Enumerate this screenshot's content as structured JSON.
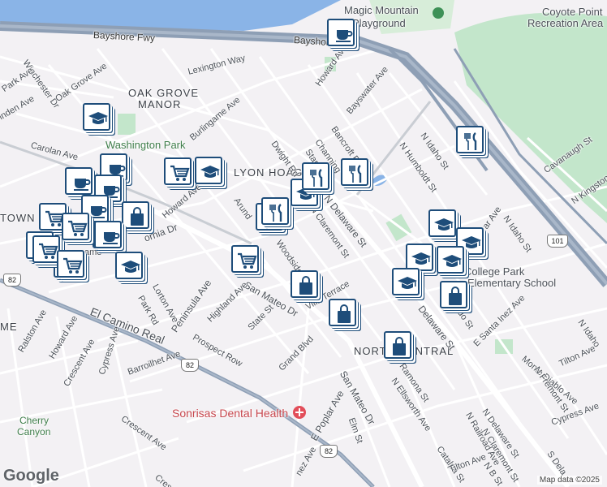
{
  "colors": {
    "pin_border": "#1e4d7a",
    "water": "#8ab4e7",
    "park": "#c3e6cb",
    "freeway": "#8e9fb5"
  },
  "labels": {
    "bayshore_fwy_1": "Bayshore Fwy",
    "bayshore_fwy_2": "Bayshore Fwy",
    "magic_mountain": "Magic Mountain",
    "playground": "Playground",
    "coyote_point_1": "Coyote Point",
    "coyote_point_2": "Recreation Area",
    "oak_grove_1": "OAK GROVE",
    "oak_grove_2": "MANOR",
    "washington_park": "Washington Park",
    "lyon_hoag": "LYON HOAG",
    "college_park_1": "College Park",
    "college_park_2": "Elementary School",
    "north_central": "NORTH CENTRAL",
    "sonrisas": "Sonrisas Dental Health",
    "cherry_1": "Cherry",
    "cherry_2": "Canyon",
    "town": "TOWN",
    "me": "ME",
    "ame": "ame",
    "lexington": "Lexington Way",
    "howard_ave_top": "Howard Ave",
    "winchester": "Winchester Dr",
    "park_ave_top": "Park Ave",
    "oak_grove_ave": "Oak Grove Ave",
    "linden": "inden Ave",
    "carolan": "Carolan Ave",
    "burlingame": "Burlingame Ave",
    "bayswater": "Bayswater Ave",
    "bancroft": "Bancroft Rd",
    "channing": "Channing",
    "stanley": "Stanl",
    "dwight": "Dwight Rd",
    "n_idaho_1": "N Idaho St",
    "n_humboldt": "N Humboldt St",
    "cavanaugh": "Cavanaugh St",
    "n_kingston": "N Kingston St",
    "n_idaho_2": "N Idaho St",
    "bar_ave": "ar Ave",
    "n_delaware_1": "N Delaware St",
    "n_claremont_1": "N Claremont St",
    "arundel": "Arund",
    "woodside": "Woodside",
    "howard_ave_mid": "Howard Ave",
    "california": "ornia Dr",
    "lorton": "Lorton Ave",
    "peninsula": "Peninsula Ave",
    "san_mateo_dr_1": "San Mateo Dr",
    "villa_terrace": "Villa Terrace",
    "highland": "Highland Ave",
    "state_st": "State St",
    "park_rd": "Park Rd",
    "el_camino": "El Camino Real",
    "prospect": "Prospect Row",
    "barroilhet": "Barroilhet Ave",
    "ralston": "Ralston Ave",
    "howard_ave_low": "Howard Ave",
    "crescent_1": "Crescent Ave",
    "cypress_1": "Cypress Ave",
    "crescent_2": "Crescent Ave",
    "crescent_3": "Crescen",
    "grand_blvd": "Grand Blvd",
    "san_mateo_dr_2": "San Mateo Dr",
    "e_poplar": "E Poplar Ave",
    "elm_st": "Elm St",
    "n_ellsworth": "N Ellsworth Ave",
    "ramona": "Ramona St",
    "delaware_2": "Delaware St",
    "prado": "rado St",
    "e_santa_inez": "E Santa Inez Ave",
    "monte_diablo": "Monte Diablo Ave",
    "n_fremont": "N Fremont St",
    "tilton_1": "Tilton Ave",
    "n_delaware_3": "N Delaware St",
    "n_claremont_2": "N Claremont St",
    "n_railroad": "N Railroad Ave",
    "catalpa": "Catalpa St",
    "tilton_2": "Tilton Ave",
    "n_b_st": "N B St",
    "s_delaware": "S Dela",
    "cypress_2": "Cypress Ave",
    "n_idaho_3": "N Idaho",
    "inez": "nez Ave",
    "shield_82_a": "82",
    "shield_82_b": "82",
    "shield_82_c": "82",
    "shield_101": "101",
    "google": "Google",
    "map_data": "Map data ©2025"
  },
  "markers": [
    {
      "type": "cafe"
    },
    {
      "type": "school"
    },
    {
      "type": "cafe"
    },
    {
      "type": "cafe"
    },
    {
      "type": "cart"
    },
    {
      "type": "school"
    },
    {
      "type": "cafe"
    },
    {
      "type": "cafe"
    },
    {
      "type": "cart"
    },
    {
      "type": "cafe"
    },
    {
      "type": "bag"
    },
    {
      "type": "cart"
    },
    {
      "type": "cart"
    },
    {
      "type": "cafe"
    },
    {
      "type": "cart"
    },
    {
      "type": "cart"
    },
    {
      "type": "school"
    },
    {
      "type": "cart"
    },
    {
      "type": "cart"
    },
    {
      "type": "bag"
    },
    {
      "type": "restaurant"
    },
    {
      "type": "school"
    },
    {
      "type": "restaurant"
    },
    {
      "type": "restaurant"
    },
    {
      "type": "restaurant"
    },
    {
      "type": "restaurant"
    },
    {
      "type": "bag"
    },
    {
      "type": "bag"
    },
    {
      "type": "school"
    },
    {
      "type": "school"
    },
    {
      "type": "school"
    },
    {
      "type": "school"
    },
    {
      "type": "school"
    },
    {
      "type": "bag"
    },
    {
      "type": "bag"
    }
  ]
}
